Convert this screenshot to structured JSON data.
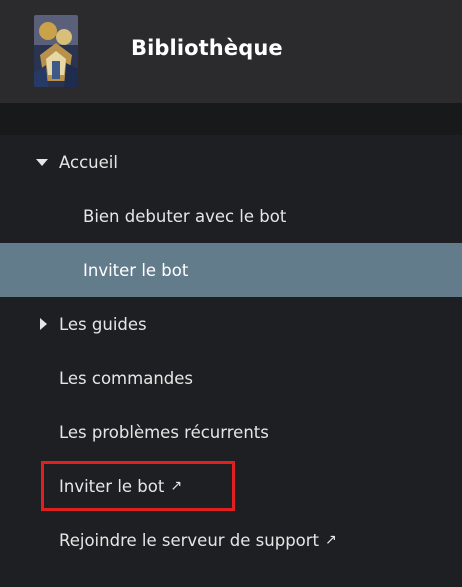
{
  "header": {
    "title": "Bibliothèque",
    "logo": "character-avatar"
  },
  "nav": {
    "items": [
      {
        "label": "Accueil",
        "state": "expanded"
      },
      {
        "label": "Bien debuter avec le bot"
      },
      {
        "label": "Inviter le bot",
        "active": true
      },
      {
        "label": "Les guides",
        "state": "collapsed"
      },
      {
        "label": "Les commandes"
      },
      {
        "label": "Les problèmes récurrents"
      },
      {
        "label": "Inviter le bot",
        "external_icon": "↗"
      },
      {
        "label": "Rejoindre le serveur de support",
        "external_icon": "↗"
      }
    ]
  },
  "colors": {
    "header_bg": "#2b2b2d",
    "nav_bg": "#1e1f22",
    "active_bg": "#637c8c",
    "highlight_border": "#e0201f"
  }
}
